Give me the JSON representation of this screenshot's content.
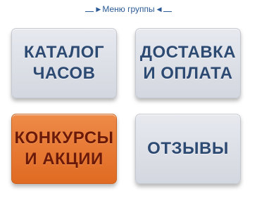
{
  "menu": {
    "title": "Меню группы",
    "arrow_right_icon": "▶",
    "arrow_left_icon": "◀"
  },
  "tiles": [
    {
      "label": "КАТАЛОГ\nЧАСОВ",
      "active": false
    },
    {
      "label": "ДОСТАВКА\nИ ОПЛАТА",
      "active": false
    },
    {
      "label": "КОНКУРСЫ\nИ АКЦИИ",
      "active": true
    },
    {
      "label": "ОТЗЫВЫ",
      "active": false
    }
  ],
  "colors": {
    "tile_bg": "#dcdfe6",
    "tile_active_bg": "#e8792f",
    "label_text": "#2d4a73",
    "active_label_text": "#6b1a0a",
    "header_link": "#2b5a96"
  }
}
